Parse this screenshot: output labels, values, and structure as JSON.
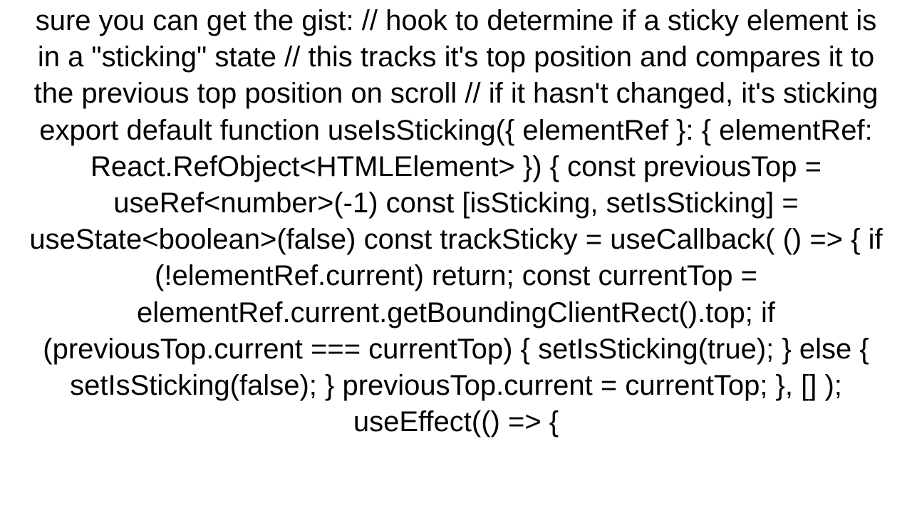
{
  "content": "sure you can get the gist: // hook to determine if a sticky element is in a \"sticking\" state // this tracks it's top position and compares it to the previous top position on scroll // if it hasn't changed, it's sticking export default function useIsSticking({ elementRef }: { elementRef: React.RefObject<HTMLElement> }) {   const previousTop = useRef<number>(-1)   const [isSticking, setIsSticking] = useState<boolean>(false)    const trackSticky = useCallback(     () => {       if (!elementRef.current) return;       const currentTop = elementRef.current.getBoundingClientRect().top;       if (previousTop.current === currentTop) {         setIsSticking(true);       } else {         setIsSticking(false);       }       previousTop.current = currentTop;     }, []   );    useEffect(() => {"
}
